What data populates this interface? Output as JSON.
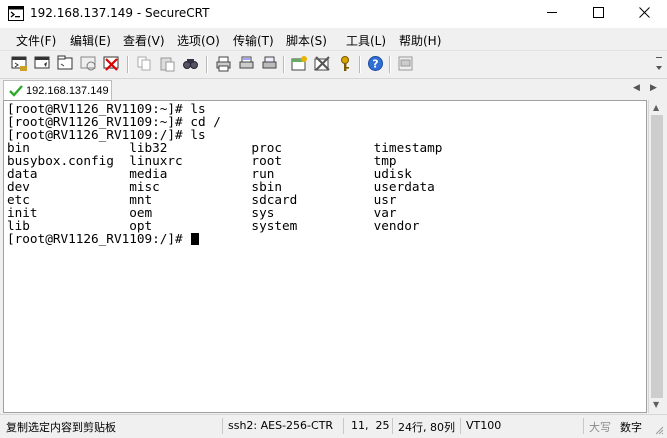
{
  "window": {
    "title": "192.168.137.149 - SecureCRT",
    "app_icon": "securecrt-icon",
    "controls": [
      "minimize-icon",
      "maximize-icon",
      "close-icon"
    ]
  },
  "menu": [
    "文件(F)",
    "编辑(E)",
    "查看(V)",
    "选项(O)",
    "传输(T)",
    "脚本(S)",
    "工具(L)",
    "帮助(H)"
  ],
  "toolbar_icons": [
    "connect-icon",
    "quick-connect-icon",
    "connect-in-tab-icon",
    "reconnect-icon",
    "disconnect-icon",
    "copy-icon",
    "paste-icon",
    "find-icon",
    "print-icon",
    "print-selection-icon",
    "print-setup-icon",
    "session-options-icon",
    "global-options-icon",
    "keymap-icon",
    "help-icon",
    "sftp-icon"
  ],
  "tab": {
    "label": "192.168.137.149",
    "status_icon": "connected-check-icon",
    "status_color": "#2fa82f"
  },
  "terminal": {
    "lines": [
      "[root@RV1126_RV1109:~]# ls",
      "[root@RV1126_RV1109:~]# cd /",
      "[root@RV1126_RV1109:/]# ls",
      "bin             lib32           proc            timestamp",
      "busybox.config  linuxrc         root            tmp",
      "data            media           run             udisk",
      "dev             misc            sbin            userdata",
      "etc             mnt             sdcard          usr",
      "init            oem             sys             var",
      "lib             opt             system          vendor",
      "[root@RV1126_RV1109:/]# "
    ],
    "cursor_line": 11,
    "cursor_col": 25
  },
  "status": {
    "message": "复制选定内容到剪贴板",
    "protocol": "ssh2: AES-256-CTR",
    "position": "11,  25",
    "size": "24行, 80列",
    "emulation": "VT100",
    "caps": "大写",
    "num": "数字"
  }
}
